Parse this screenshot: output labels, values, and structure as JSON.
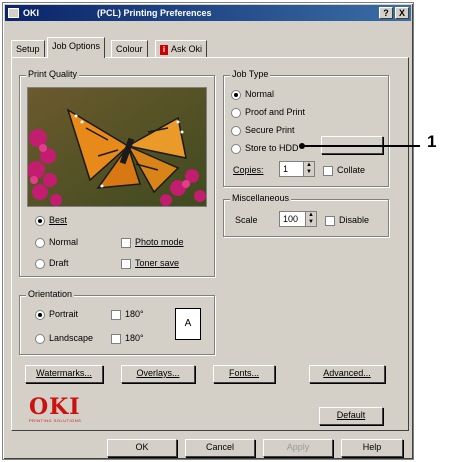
{
  "titlebar": {
    "app": "OKI",
    "title": "(PCL) Printing Preferences",
    "help_btn": "?",
    "close_btn": "X"
  },
  "tabs": [
    {
      "label": "Setup"
    },
    {
      "label": "Job Options"
    },
    {
      "label": "Colour"
    },
    {
      "label": "Ask Oki"
    }
  ],
  "print_quality": {
    "label": "Print Quality",
    "best": "Best",
    "normal": "Normal",
    "draft": "Draft",
    "photo_mode": "Photo mode",
    "toner_save": "Toner save",
    "selected": "Best"
  },
  "orientation": {
    "label": "Orientation",
    "portrait": "Portrait",
    "landscape": "Landscape",
    "rotate1": "180°",
    "rotate2": "180°",
    "preview_letter": "A",
    "selected": "Portrait"
  },
  "job_type": {
    "label": "Job Type",
    "normal": "Normal",
    "proof_print": "Proof and Print",
    "secure_print": "Secure Print",
    "store_hdd": "Store to HDD",
    "more_btn": "...",
    "copies_label": "Copies:",
    "copies_value": "1",
    "collate": "Collate",
    "selected": "Normal"
  },
  "misc": {
    "label": "Miscellaneous",
    "scale_label": "Scale",
    "scale_value": "100",
    "disable": "Disable"
  },
  "buttons": {
    "watermarks": "Watermarks...",
    "overlays": "Overlays...",
    "fonts": "Fonts...",
    "advanced": "Advanced...",
    "default": "Default"
  },
  "logo": {
    "text": "OKI",
    "tagline": "PRINTING SOLUTIONS"
  },
  "footer": {
    "ok": "OK",
    "cancel": "Cancel",
    "apply": "Apply",
    "help": "Help"
  },
  "callout": "1"
}
